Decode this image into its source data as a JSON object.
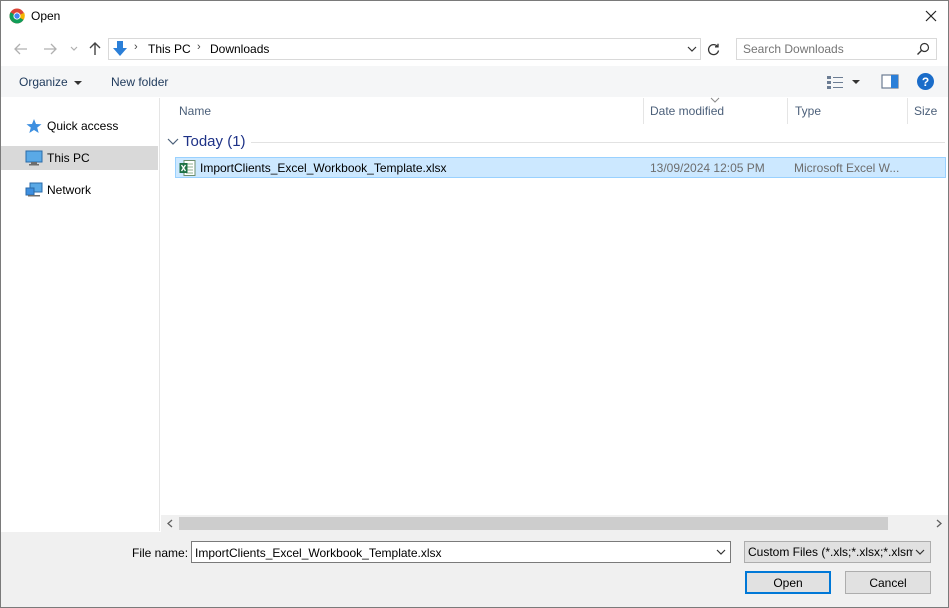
{
  "window": {
    "title": "Open",
    "app_icon": "chrome-icon"
  },
  "address_bar": {
    "crumbs": [
      "This PC",
      "Downloads"
    ],
    "location_icon": "downloads-arrow-icon"
  },
  "search": {
    "placeholder": "Search Downloads"
  },
  "toolbar": {
    "organize_label": "Organize",
    "new_folder_label": "New folder",
    "help_label": "?"
  },
  "nav_pane": {
    "items": [
      {
        "label": "Quick access",
        "icon": "star-icon",
        "selected": false
      },
      {
        "label": "This PC",
        "icon": "computer-icon",
        "selected": true
      },
      {
        "label": "Network",
        "icon": "network-icon",
        "selected": false
      }
    ]
  },
  "columns": {
    "name": "Name",
    "date_modified": "Date modified",
    "type": "Type",
    "size": "Size"
  },
  "group": {
    "label": "Today (1)"
  },
  "files": [
    {
      "name": "ImportClients_Excel_Workbook_Template.xlsx",
      "date_modified": "13/09/2024 12:05 PM",
      "type": "Microsoft Excel W...",
      "icon": "excel-file-icon",
      "selected": true
    }
  ],
  "bottom": {
    "file_name_label": "File name:",
    "file_name_value": "ImportClients_Excel_Workbook_Template.xlsx",
    "filter_value": "Custom Files (*.xls;*.xlsx;*.xlsm",
    "open_label": "Open",
    "cancel_label": "Cancel"
  },
  "colors": {
    "selection": "#cce8ff",
    "selection_border": "#99d1ff",
    "group_text": "#1e3287",
    "accent": "#0078d7"
  }
}
